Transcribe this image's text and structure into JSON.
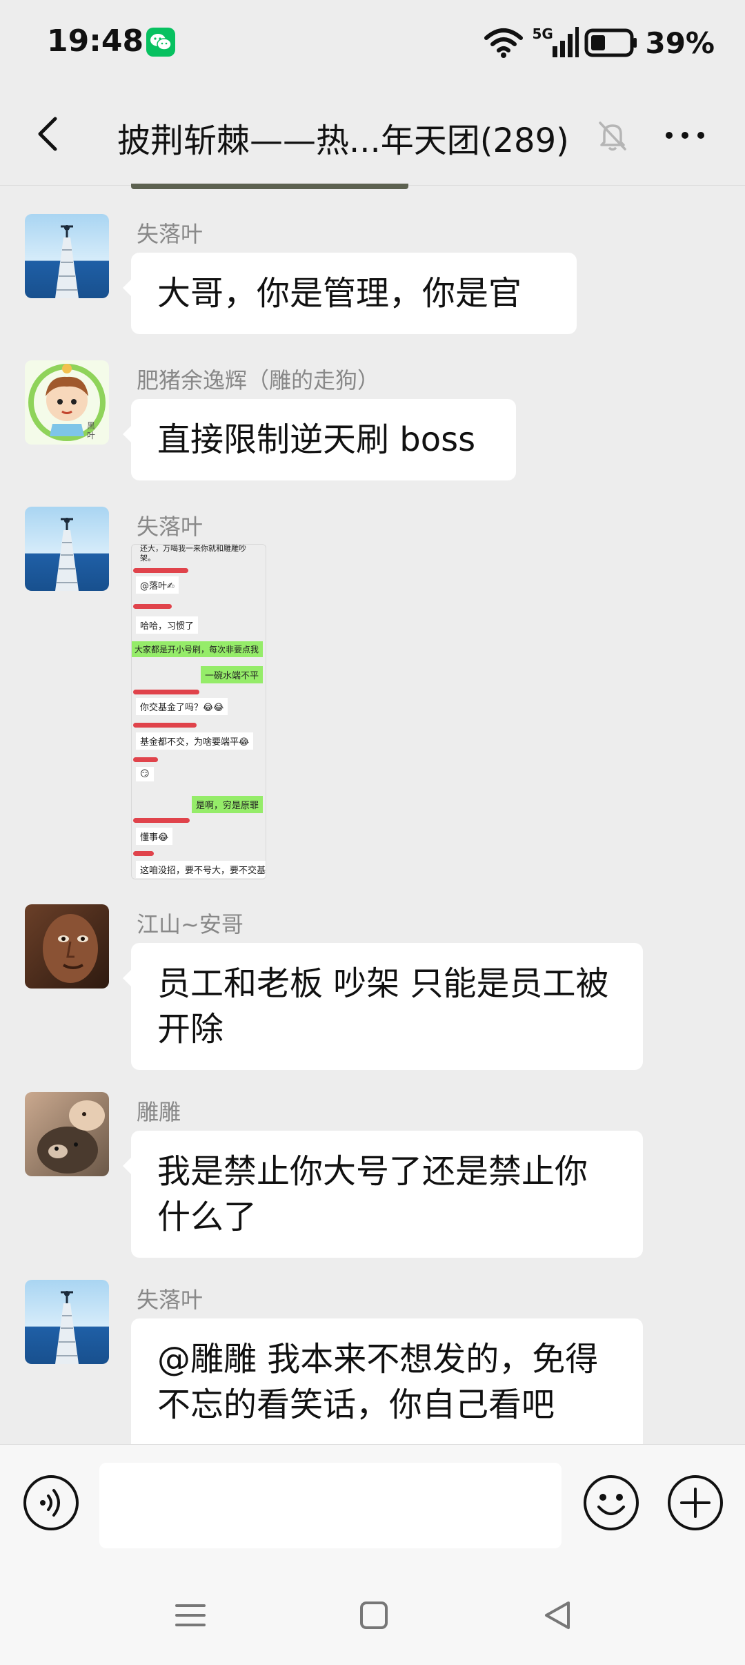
{
  "status": {
    "time": "19:48",
    "network": "5G",
    "battery": "39%"
  },
  "header": {
    "title": "披荆斩棘——热...年天团(289)"
  },
  "messages": [
    {
      "sender": "失落叶",
      "text": "大哥，你是管理，你是官"
    },
    {
      "sender": "肥猪余逸辉（雕的走狗）",
      "text": "直接限制逆天刷 boss"
    },
    {
      "sender": "失落叶",
      "type": "image"
    },
    {
      "sender": "江山~安哥",
      "text": "员工和老板 吵架  只能是员工被开除"
    },
    {
      "sender": "雕雕",
      "text": "我是禁止你大号了还是禁止你什么了"
    },
    {
      "sender": "失落叶",
      "text": "@雕雕  我本来不想发的，免得不忘的看笑话，你自己看吧"
    }
  ],
  "screenshot_lines": [
    "还大，万喝我一来你就和雕雕吵架。",
    "@落叶✍",
    "哈哈，习惯了",
    "大家都是开小号刷，每次非要点我",
    "一碗水端不平",
    "你交基金了吗？😂😂",
    "基金都不交，为啥要端平😂",
    "😏",
    "是啊，穷是原罪",
    "懂事😂",
    "这咱没招，要不号大，要不交基"
  ],
  "avatar_caption": "黑叶",
  "colors": {
    "background": "#ededed",
    "bubble": "#ffffff",
    "accent_green": "#07c160",
    "sender_gray": "#888888"
  },
  "icons": {
    "back": "chevron-left-icon",
    "mute": "bell-off-icon",
    "more": "more-dots-icon",
    "voice": "voice-icon",
    "emoji": "emoji-icon",
    "plus": "plus-icon"
  }
}
